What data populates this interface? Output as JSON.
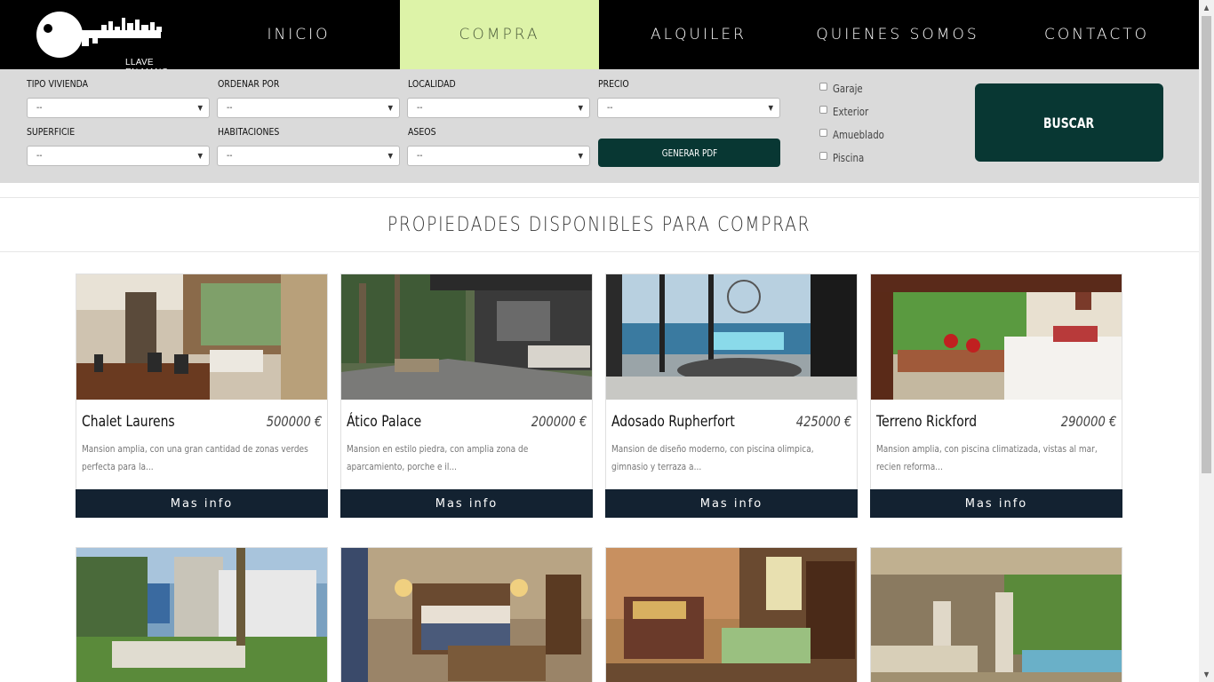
{
  "brand": {
    "name": "LLAVE EN MANO"
  },
  "nav": {
    "items": [
      {
        "label": "INICIO"
      },
      {
        "label": "COMPRA"
      },
      {
        "label": "ALQUILER"
      },
      {
        "label": "QUIENES  SOMOS"
      },
      {
        "label": "CONTACTO"
      }
    ],
    "active": "COMPRA"
  },
  "filters": {
    "tipo_vivienda": {
      "label": "TIPO VIVIENDA",
      "value": "--"
    },
    "ordenar_por": {
      "label": "ORDENAR POR",
      "value": "--"
    },
    "localidad": {
      "label": "LOCALIDAD",
      "value": "--"
    },
    "precio": {
      "label": "PRECIO",
      "value": "--"
    },
    "superficie": {
      "label": "SUPERFICIE",
      "value": "--"
    },
    "habitaciones": {
      "label": "HABITACIONES",
      "value": "--"
    },
    "aseos": {
      "label": "ASEOS",
      "value": "--"
    },
    "pdf_button": "GENERAR PDF",
    "checkboxes": [
      {
        "label": "Garaje",
        "checked": false
      },
      {
        "label": "Exterior",
        "checked": false
      },
      {
        "label": "Amueblado",
        "checked": false
      },
      {
        "label": "Piscina",
        "checked": false
      }
    ],
    "search_button": "BUSCAR"
  },
  "section": {
    "title": "PROPIEDADES DISPONIBLES PARA COMPRAR"
  },
  "properties": [
    {
      "name": "Chalet Laurens",
      "price": "500000 €",
      "desc": "Mansion amplia, con una gran cantidad de zonas verdes perfecta para la...",
      "button": "Mas  info"
    },
    {
      "name": "Ático Palace",
      "price": "200000 €",
      "desc": "Mansion en estilo piedra, con amplia zona de aparcamiento, porche e il...",
      "button": "Mas  info"
    },
    {
      "name": "Adosado Rupherfort",
      "price": "425000 €",
      "desc": "Mansion de diseño moderno, con piscina olimpica, gimnasio y terraza a...",
      "button": "Mas  info"
    },
    {
      "name": "Terreno Rickford",
      "price": "290000 €",
      "desc": "Mansion amplia, con piscina climatizada, vistas al mar, recien reforma...",
      "button": "Mas  info"
    }
  ],
  "colors": {
    "nav_bg": "#000000",
    "nav_active": "#ddf3a8",
    "filter_bg": "#dadada",
    "button_dark": "#083733",
    "card_button": "#132231"
  }
}
